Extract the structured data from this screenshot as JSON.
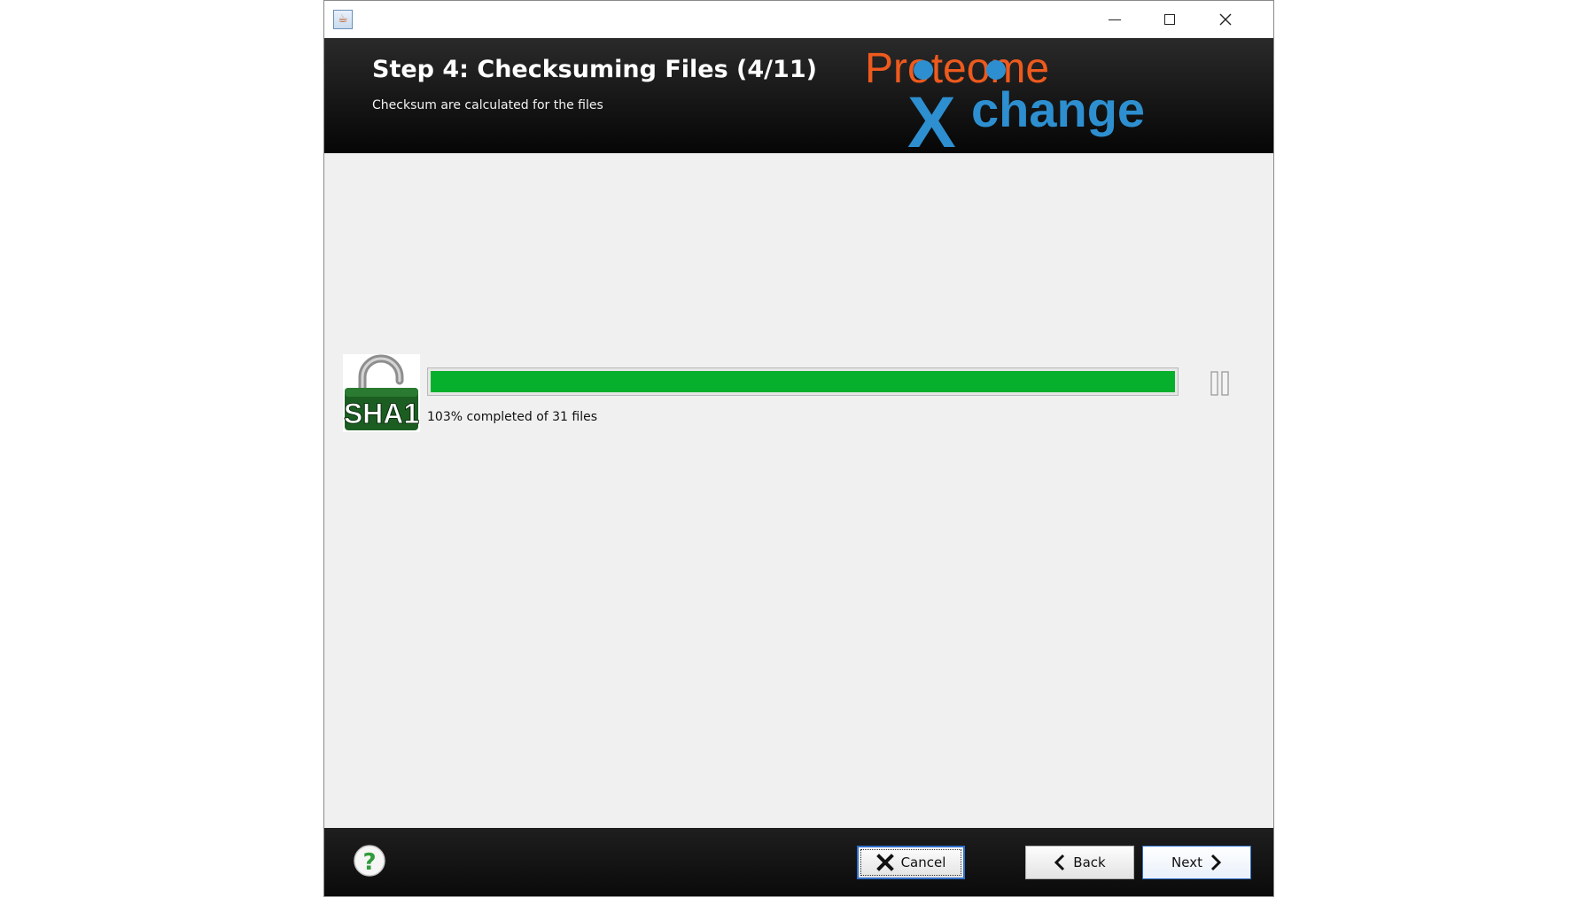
{
  "window": {
    "controls": {
      "minimize": "minimize-icon",
      "maximize": "maximize-icon",
      "close": "close-icon"
    }
  },
  "header": {
    "title": "Step 4: Checksuming Files (4/11)",
    "subtitle": "Checksum are calculated for the files",
    "logo": {
      "line1": "Proteome",
      "line2_initial": "X",
      "line2_rest": "change",
      "colors": {
        "orange": "#ee5a1e",
        "blue": "#2d8fd0"
      }
    }
  },
  "content": {
    "sha_icon": {
      "label": "SHA1",
      "icon": "sha1-lock-icon"
    },
    "progress": {
      "percent_fill": 100,
      "text": "103% completed of 31 files",
      "color": "#06b02c"
    },
    "pause_icon": "pause-icon"
  },
  "footer": {
    "help_icon": "help-icon",
    "cancel_label": "Cancel",
    "back_label": "Back",
    "next_label": "Next"
  }
}
